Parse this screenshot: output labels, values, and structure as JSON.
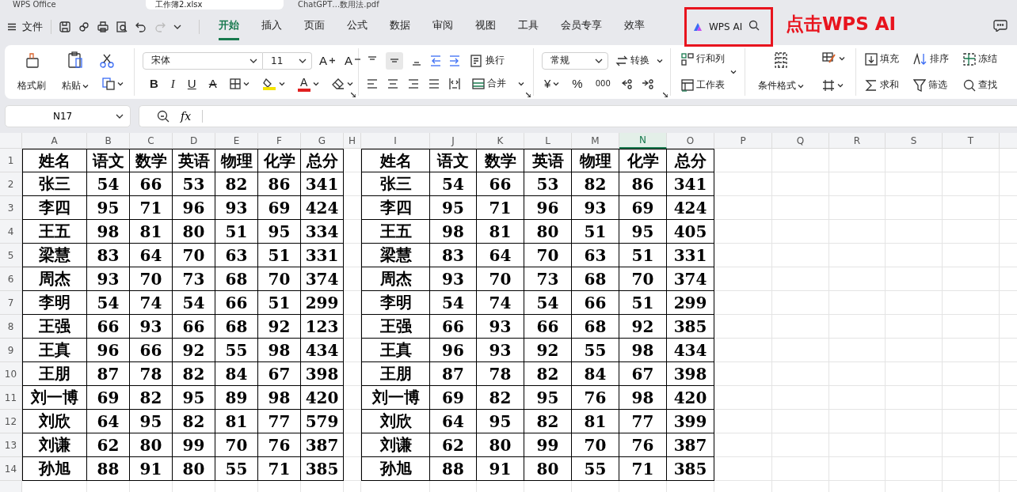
{
  "app_tabs": [
    {
      "label": "WPS Office",
      "selected": false
    },
    {
      "label": "工作簿2.xlsx",
      "selected": true
    },
    {
      "label": "ChatGPT…数用法.pdf",
      "selected": false
    }
  ],
  "menu": {
    "file": "文件",
    "tabs": [
      {
        "label": "开始",
        "selected": true
      },
      {
        "label": "插入",
        "selected": false
      },
      {
        "label": "页面",
        "selected": false
      },
      {
        "label": "公式",
        "selected": false
      },
      {
        "label": "数据",
        "selected": false
      },
      {
        "label": "审阅",
        "selected": false
      },
      {
        "label": "视图",
        "selected": false
      },
      {
        "label": "工具",
        "selected": false
      },
      {
        "label": "会员专享",
        "selected": false
      },
      {
        "label": "效率",
        "selected": false
      }
    ],
    "ai": "WPS AI"
  },
  "ribbon": {
    "clipboard": {
      "format_painter": "格式刷",
      "paste": "粘贴"
    },
    "font": {
      "name": "宋体",
      "size": "11",
      "grow": "A",
      "shrink": "A",
      "bold": "B",
      "italic": "I",
      "underline": "U",
      "strike": "A",
      "font_color": "A"
    },
    "alignment": {
      "wrap": "换行",
      "merge": "合并"
    },
    "number": {
      "format": "常规",
      "convert": "转换",
      "currency": "¥",
      "percent": "%",
      "thousands": "000"
    },
    "cells": {
      "rows_cols": "行和列",
      "worksheet": "工作表",
      "conditional": "条件格式"
    },
    "editing": {
      "fill": "填充",
      "sort": "排序",
      "freeze": "冻结",
      "sum": "求和",
      "filter": "筛选",
      "find": "查找"
    }
  },
  "formula_bar": {
    "name_box": "N17",
    "fx": "fx"
  },
  "sheet": {
    "columns": [
      {
        "label": "A",
        "selected": false
      },
      {
        "label": "B",
        "selected": false
      },
      {
        "label": "C",
        "selected": false
      },
      {
        "label": "D",
        "selected": false
      },
      {
        "label": "E",
        "selected": false
      },
      {
        "label": "F",
        "selected": false
      },
      {
        "label": "G",
        "selected": false
      },
      {
        "label": "H",
        "selected": false
      },
      {
        "label": "I",
        "selected": false
      },
      {
        "label": "J",
        "selected": false
      },
      {
        "label": "K",
        "selected": false
      },
      {
        "label": "L",
        "selected": false
      },
      {
        "label": "M",
        "selected": false
      },
      {
        "label": "N",
        "selected": true
      },
      {
        "label": "O",
        "selected": false
      },
      {
        "label": "P",
        "selected": false
      },
      {
        "label": "Q",
        "selected": false
      },
      {
        "label": "R",
        "selected": false
      },
      {
        "label": "S",
        "selected": false
      },
      {
        "label": "T",
        "selected": false
      }
    ],
    "rows": [
      {
        "number": "1",
        "cells": [
          "姓名",
          "语文",
          "数学",
          "英语",
          "物理",
          "化学",
          "总分",
          "",
          "姓名",
          "语文",
          "数学",
          "英语",
          "物理",
          "化学",
          "总分"
        ]
      },
      {
        "number": "2",
        "cells": [
          "张三",
          "54",
          "66",
          "53",
          "82",
          "86",
          "341",
          "",
          "张三",
          "54",
          "66",
          "53",
          "82",
          "86",
          "341"
        ]
      },
      {
        "number": "3",
        "cells": [
          "李四",
          "95",
          "71",
          "96",
          "93",
          "69",
          "424",
          "",
          "李四",
          "95",
          "71",
          "96",
          "93",
          "69",
          "424"
        ]
      },
      {
        "number": "4",
        "cells": [
          "王五",
          "98",
          "81",
          "80",
          "51",
          "95",
          "334",
          "",
          "王五",
          "98",
          "81",
          "80",
          "51",
          "95",
          "405"
        ]
      },
      {
        "number": "5",
        "cells": [
          "梁慧",
          "83",
          "64",
          "70",
          "63",
          "51",
          "331",
          "",
          "梁慧",
          "83",
          "64",
          "70",
          "63",
          "51",
          "331"
        ]
      },
      {
        "number": "6",
        "cells": [
          "周杰",
          "93",
          "70",
          "73",
          "68",
          "70",
          "374",
          "",
          "周杰",
          "93",
          "70",
          "73",
          "68",
          "70",
          "374"
        ]
      },
      {
        "number": "7",
        "cells": [
          "李明",
          "54",
          "74",
          "54",
          "66",
          "51",
          "299",
          "",
          "李明",
          "54",
          "74",
          "54",
          "66",
          "51",
          "299"
        ]
      },
      {
        "number": "8",
        "cells": [
          "王强",
          "66",
          "93",
          "66",
          "68",
          "92",
          "123",
          "",
          "王强",
          "66",
          "93",
          "66",
          "68",
          "92",
          "385"
        ]
      },
      {
        "number": "9",
        "cells": [
          "王真",
          "96",
          "66",
          "92",
          "55",
          "98",
          "434",
          "",
          "王真",
          "96",
          "93",
          "92",
          "55",
          "98",
          "434"
        ]
      },
      {
        "number": "10",
        "cells": [
          "王朋",
          "87",
          "78",
          "82",
          "84",
          "67",
          "398",
          "",
          "王朋",
          "87",
          "78",
          "82",
          "84",
          "67",
          "398"
        ]
      },
      {
        "number": "11",
        "cells": [
          "刘一博",
          "69",
          "82",
          "95",
          "89",
          "98",
          "420",
          "",
          "刘一博",
          "69",
          "82",
          "95",
          "76",
          "98",
          "420"
        ]
      },
      {
        "number": "12",
        "cells": [
          "刘欣",
          "64",
          "95",
          "82",
          "81",
          "77",
          "579",
          "",
          "刘欣",
          "64",
          "95",
          "82",
          "81",
          "77",
          "399"
        ]
      },
      {
        "number": "13",
        "cells": [
          "刘谦",
          "62",
          "80",
          "99",
          "70",
          "76",
          "387",
          "",
          "刘谦",
          "62",
          "80",
          "99",
          "70",
          "76",
          "387"
        ]
      },
      {
        "number": "14",
        "cells": [
          "孙旭",
          "88",
          "91",
          "80",
          "55",
          "71",
          "385",
          "",
          "孙旭",
          "88",
          "91",
          "80",
          "55",
          "71",
          "385"
        ]
      }
    ]
  },
  "annotation": {
    "text": "点击WPS AI"
  }
}
